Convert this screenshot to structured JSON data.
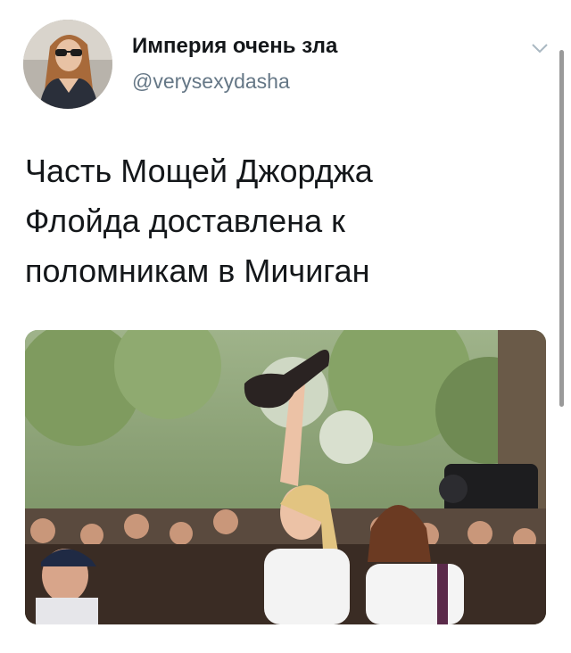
{
  "author": {
    "display_name": "Империя очень зла",
    "username": "@verysexydasha",
    "avatar_icon": "profile-photo"
  },
  "tweet": {
    "lines": [
      "Часть Мощей Джорджа",
      "Флойда доставлена к",
      "поломникам в Мичиган"
    ]
  },
  "icons": {
    "menu": "chevron-down-icon"
  },
  "colors": {
    "text": "#14171a",
    "secondary_text": "#657786",
    "background": "#ffffff"
  }
}
